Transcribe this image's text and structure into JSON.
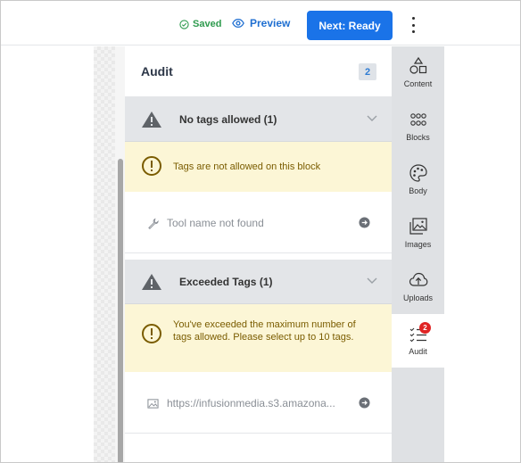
{
  "topbar": {
    "saved_label": "Saved",
    "preview_label": "Preview",
    "next_label": "Next: Ready"
  },
  "panel": {
    "title": "Audit",
    "count": "2",
    "groups": [
      {
        "title": "No tags allowed (1)",
        "notice": "Tags are not allowed on this block",
        "item": "Tool name not found",
        "item_icon": "wrench-icon"
      },
      {
        "title": "Exceeded Tags (1)",
        "notice": "You've exceeded the maximum number of tags allowed. Please select up to 10 tags.",
        "item": "https://infusionmedia.s3.amazona...",
        "item_icon": "image-icon"
      }
    ]
  },
  "sidebar": {
    "items": [
      {
        "label": "Content",
        "icon": "shapes-icon"
      },
      {
        "label": "Blocks",
        "icon": "grid-dots-icon"
      },
      {
        "label": "Body",
        "icon": "palette-icon"
      },
      {
        "label": "Images",
        "icon": "images-icon"
      },
      {
        "label": "Uploads",
        "icon": "cloud-upload-icon"
      },
      {
        "label": "Audit",
        "icon": "checklist-icon",
        "badge": "2",
        "active": true
      }
    ]
  },
  "colors": {
    "primary": "#1a73e8",
    "saved": "#2e9b4e",
    "warning_bg": "#fcf6d6",
    "warning_text": "#7a5c00",
    "badge_red": "#e02424"
  }
}
